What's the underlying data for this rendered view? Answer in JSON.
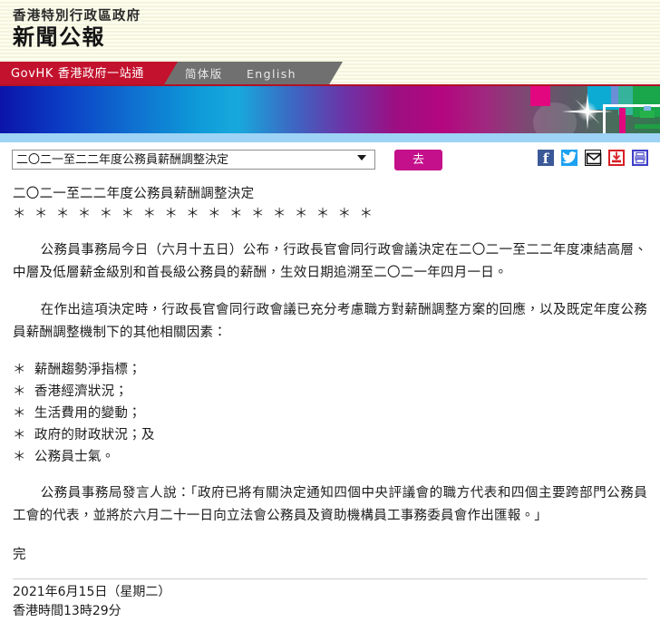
{
  "masthead": {
    "organisation": "香港特別行政區政府",
    "title": "新聞公報"
  },
  "nav": {
    "govhk_label": "GovHK 香港政府一站通",
    "simplified_label": "简体版",
    "english_label": "English"
  },
  "toolbar": {
    "select_value": "二〇二一至二二年度公務員薪酬調整決定",
    "go_label": "去",
    "share_icons": [
      {
        "name": "facebook-icon",
        "glyph": "f"
      },
      {
        "name": "twitter-icon",
        "glyph": ""
      },
      {
        "name": "email-icon",
        "glyph": ""
      },
      {
        "name": "download-icon",
        "glyph": ""
      },
      {
        "name": "print-icon",
        "glyph": ""
      }
    ]
  },
  "article": {
    "headline": "二〇二一至二二年度公務員薪酬調整決定",
    "stars": "＊ ＊ ＊ ＊ ＊ ＊ ＊ ＊ ＊ ＊ ＊ ＊ ＊ ＊ ＊ ＊ ＊",
    "paragraph_1": "公務員事務局今日（六月十五日）公布，行政長官會同行政會議決定在二〇二一至二二年度凍結高層、中層及低層薪金級別和首長級公務員的薪酬，生效日期追溯至二〇二一年四月一日。",
    "paragraph_2": "在作出這項決定時，行政長官會同行政會議已充分考慮職方對薪酬調整方案的回應，以及既定年度公務員薪酬調整機制下的其他相關因素：",
    "bullets": [
      "薪酬趨勢淨指標；",
      "香港經濟狀況；",
      "生活費用的變動；",
      "政府的財政狀況；及",
      "公務員士氣。"
    ],
    "bullet_mark": "＊",
    "paragraph_3": "公務員事務局發言人說：「政府已將有關決定通知四個中央評議會的職方代表和四個主要跨部門公務員工會的代表，並將於六月二十一日向立法會公務員及資助機構員工事務委員會作出匯報。」",
    "end_mark": "完",
    "date_line": "2021年6月15日（星期二）",
    "time_line": "香港時間13時29分"
  },
  "colors": {
    "nav_red": "#c3122d",
    "nav_gray": "#707070",
    "go_button": "#c4108b",
    "masthead_bg": "#fbfbe8",
    "banner_strip": "#9ed3f5"
  }
}
